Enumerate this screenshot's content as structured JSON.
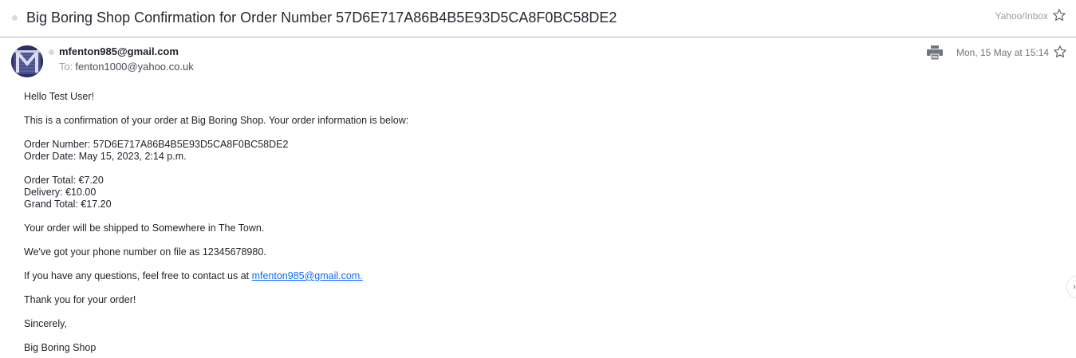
{
  "subject": "Big Boring Shop Confirmation for Order Number 57D6E717A86B4B5E93D5CA8F0BC58DE2",
  "folder": "Yahoo/Inbox",
  "sender": {
    "email": "mfenton985@gmail.com",
    "to_label": "To:",
    "to": "fenton1000@yahoo.co.uk"
  },
  "date": "Mon, 15 May at 15:14",
  "icons": {
    "print": "print-icon",
    "star": "star-icon",
    "next": "chevron-right-icon"
  },
  "body": {
    "greeting": "Hello Test User!",
    "intro": "This is a confirmation of your order at Big Boring Shop. Your order information is below:",
    "order_number": "Order Number: 57D6E717A86B4B5E93D5CA8F0BC58DE2",
    "order_date": "Order Date: May 15, 2023, 2:14 p.m.",
    "order_total": "Order Total: €7.20",
    "delivery": "Delivery: €10.00",
    "grand_total": "Grand Total: €17.20",
    "shipping": "Your order will be shipped to Somewhere in The Town.",
    "phone": "We've got your phone number on file as 12345678980.",
    "questions_prefix": "If you have any questions, feel free to contact us at ",
    "contact_link": "mfenton985@gmail.com.",
    "thanks": "Thank you for your order!",
    "sign_off": "Sincerely,",
    "signature": "Big Boring Shop"
  }
}
